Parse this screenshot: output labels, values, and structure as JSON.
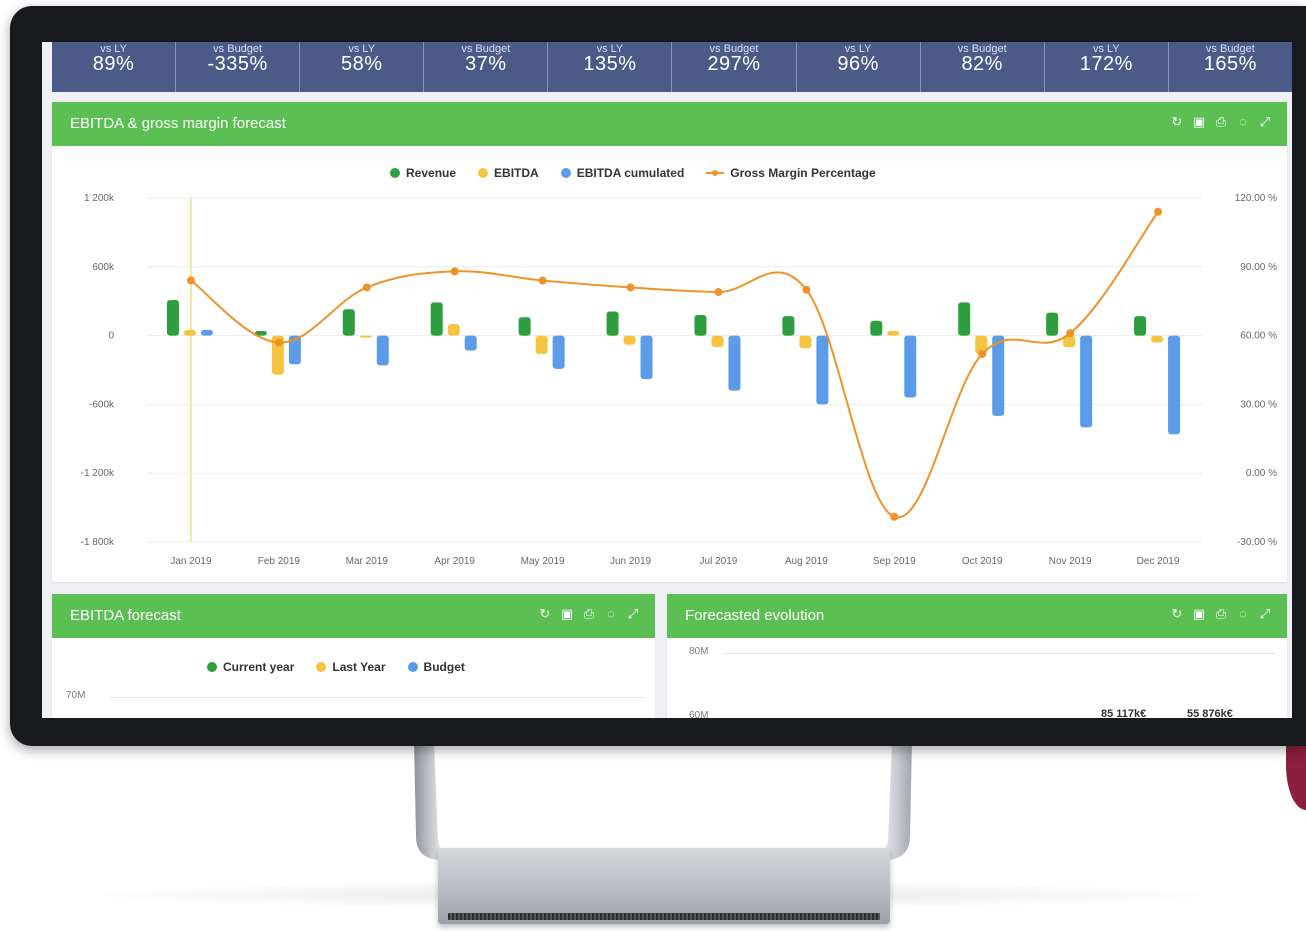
{
  "kpis": [
    {
      "label": "vs LY",
      "value": "89%"
    },
    {
      "label": "vs Budget",
      "value": "-335%"
    },
    {
      "label": "vs LY",
      "value": "58%"
    },
    {
      "label": "vs Budget",
      "value": "37%"
    },
    {
      "label": "vs LY",
      "value": "135%"
    },
    {
      "label": "vs Budget",
      "value": "297%"
    },
    {
      "label": "vs LY",
      "value": "96%"
    },
    {
      "label": "vs Budget",
      "value": "82%"
    },
    {
      "label": "vs LY",
      "value": "172%"
    },
    {
      "label": "vs Budget",
      "value": "165%"
    }
  ],
  "tool_icons": [
    "refresh-icon",
    "export-image-icon",
    "print-icon",
    "comment-icon",
    "expand-icon"
  ],
  "colors": {
    "panel_header": "#5bbf54",
    "kpi_bar": "#4b5a87",
    "revenue": "#2e9e3e",
    "ebitda": "#f5c542",
    "ebitda_cumulated": "#5b9be8",
    "gross_margin": "#f0922a",
    "cursor_line": "#f2e27a",
    "accent": "#8c1e3f"
  },
  "main_panel": {
    "title": "EBITDA & gross margin forecast"
  },
  "chart_data": {
    "type": "bar",
    "title": "",
    "legend_position": "top-center",
    "categories": [
      "Jan 2019",
      "Feb 2019",
      "Mar 2019",
      "Apr 2019",
      "May 2019",
      "Jun 2019",
      "Jul 2019",
      "Aug 2019",
      "Sep 2019",
      "Oct 2019",
      "Nov 2019",
      "Dec 2019"
    ],
    "y_left": {
      "ticks": [
        "1 200k",
        "600k",
        "0",
        "-600k",
        "-1 200k",
        "-1 800k"
      ],
      "range": [
        -1800000,
        1200000
      ]
    },
    "y_right": {
      "ticks": [
        "120.00 %",
        "90.00 %",
        "60.00 %",
        "30.00 %",
        "0.00 %",
        "-30.00 %"
      ],
      "range": [
        -30,
        120
      ]
    },
    "series": [
      {
        "name": "Revenue",
        "type": "bar",
        "axis": "left",
        "values": [
          310000,
          40000,
          230000,
          290000,
          160000,
          210000,
          180000,
          170000,
          130000,
          290000,
          200000,
          170000
        ]
      },
      {
        "name": "EBITDA",
        "type": "bar",
        "axis": "left",
        "values": [
          50000,
          -340000,
          0,
          100000,
          -160000,
          -80000,
          -100000,
          -110000,
          40000,
          -160000,
          -100000,
          -60000
        ]
      },
      {
        "name": "EBITDA cumulated",
        "type": "bar",
        "axis": "left",
        "values": [
          50000,
          -250000,
          -260000,
          -130000,
          -290000,
          -380000,
          -480000,
          -600000,
          -540000,
          -700000,
          -800000,
          -860000
        ]
      },
      {
        "name": "Gross Margin Percentage",
        "type": "line",
        "axis": "right",
        "values": [
          84,
          57,
          81,
          88,
          84,
          81,
          79,
          80,
          -19,
          52,
          61,
          114
        ]
      }
    ]
  },
  "ebitda_panel": {
    "title": "EBITDA forecast",
    "legend": [
      "Current year",
      "Last Year",
      "Budget"
    ],
    "y_ticks": [
      "70M"
    ]
  },
  "evolution_panel": {
    "title": "Forecasted evolution",
    "y_ticks": [
      "80M",
      "60M"
    ],
    "values": [
      "85 117k€",
      "55 876k€"
    ]
  }
}
